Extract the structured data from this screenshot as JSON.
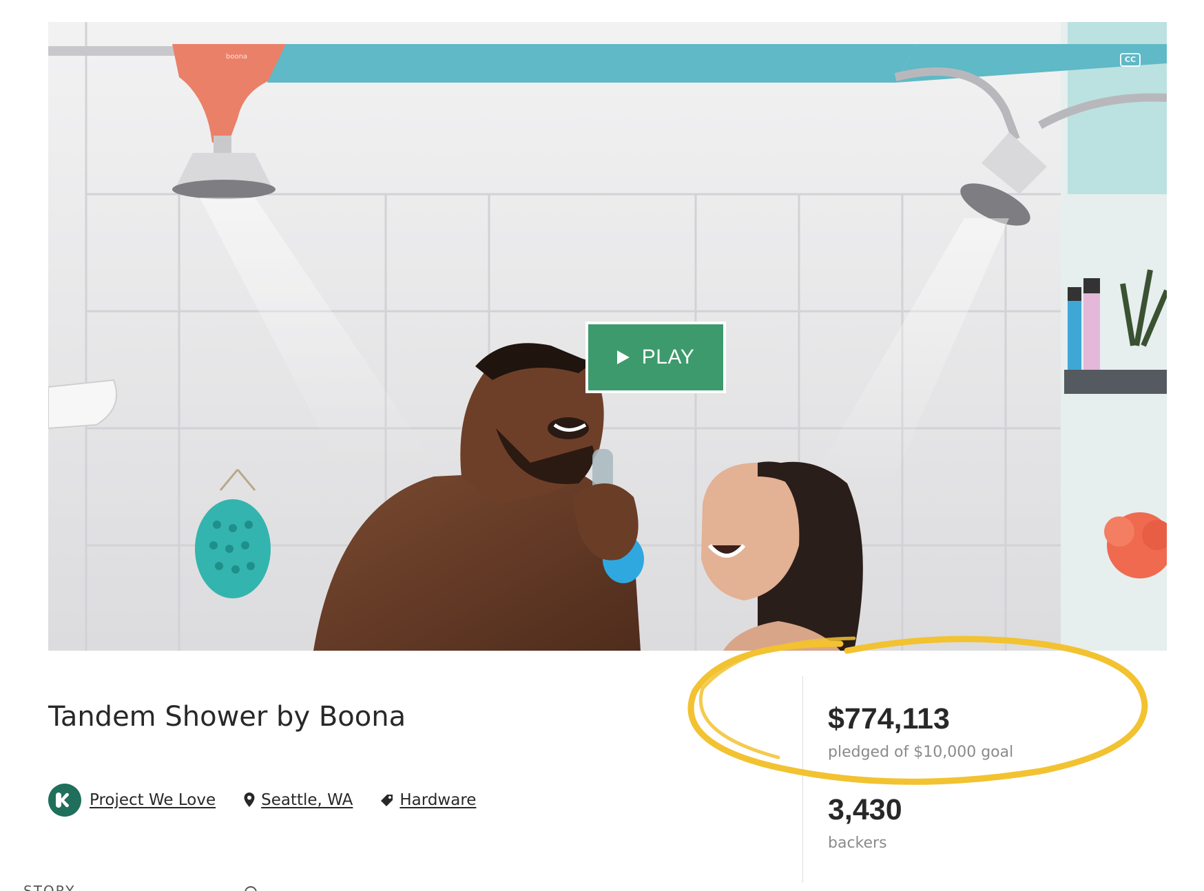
{
  "video": {
    "play_label": "PLAY",
    "cc_label": "CC",
    "brand_mark": "boona",
    "colors": {
      "play_bg": "#3d9a6d",
      "rod_blue": "#5fb9c6",
      "rod_coral": "#ea8068"
    }
  },
  "project": {
    "title": "Tandem Shower by Boona",
    "badge_icon": "kickstarter-k-icon",
    "badge_label": "Project We Love",
    "location": "Seattle, WA",
    "category": "Hardware"
  },
  "stats": {
    "pledged": "$774,113",
    "goal_text": "pledged of $10,000 goal",
    "backers": "3,430",
    "backers_label": "backers",
    "highlight_color": "#f2c230"
  },
  "tabs": {
    "story": "STORY"
  }
}
